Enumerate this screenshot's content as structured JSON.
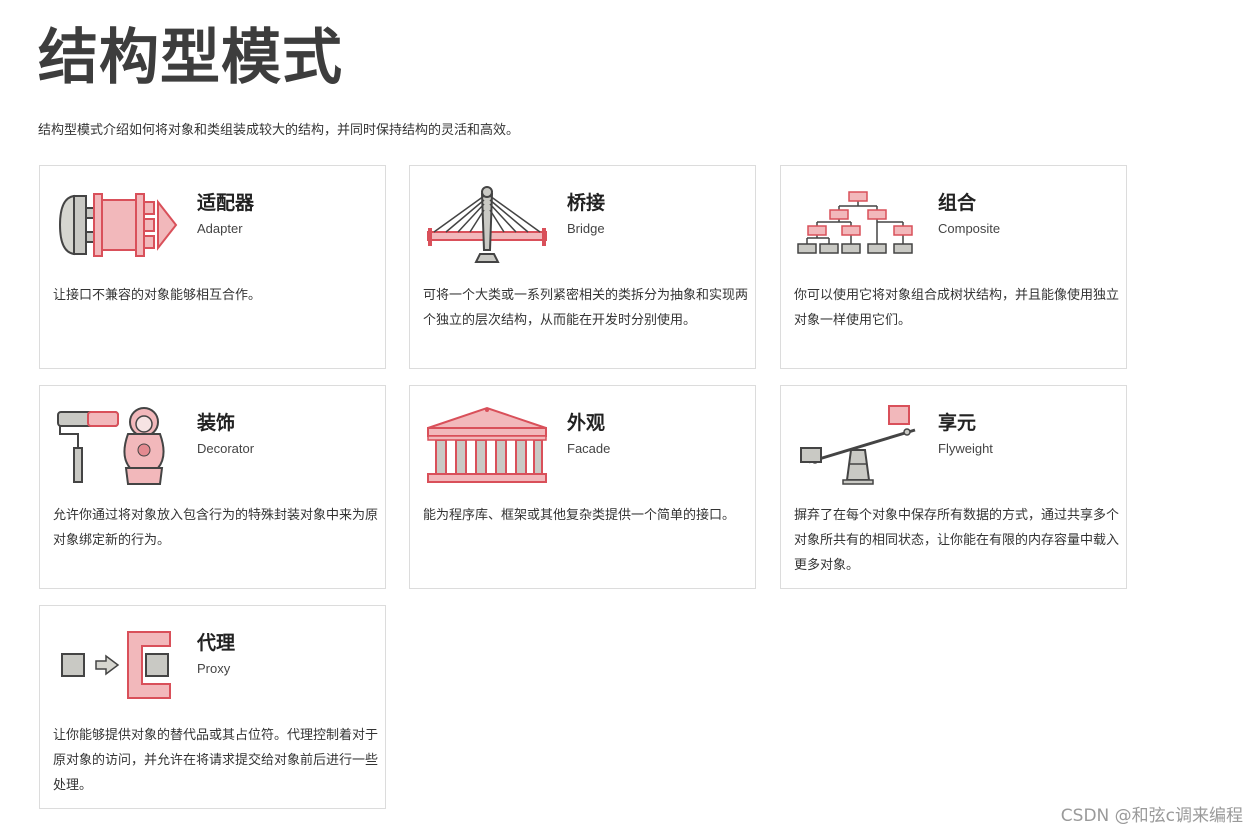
{
  "title": "结构型模式",
  "intro": "结构型模式介绍如何将对象和类组装成较大的结构，并同时保持结构的灵活和高效。",
  "patterns": [
    {
      "name": "适配器",
      "en": "Adapter",
      "desc": "让接口不兼容的对象能够相互合作。",
      "icon": "adapter-icon"
    },
    {
      "name": "桥接",
      "en": "Bridge",
      "desc": "可将一个大类或一系列紧密相关的类拆分为抽象和实现两个独立的层次结构，从而能在开发时分别使用。",
      "icon": "bridge-icon"
    },
    {
      "name": "组合",
      "en": "Composite",
      "desc": "你可以使用它将对象组合成树状结构，并且能像使用独立对象一样使用它们。",
      "icon": "composite-tree-icon"
    },
    {
      "name": "装饰",
      "en": "Decorator",
      "desc": "允许你通过将对象放入包含行为的特殊封装对象中来为原对象绑定新的行为。",
      "icon": "decorator-icon"
    },
    {
      "name": "外观",
      "en": "Facade",
      "desc": "能为程序库、框架或其他复杂类提供一个简单的接口。",
      "icon": "facade-building-icon"
    },
    {
      "name": "享元",
      "en": "Flyweight",
      "desc": "摒弃了在每个对象中保存所有数据的方式，通过共享多个对象所共有的相同状态，让你能在有限的内存容量中载入更多对象。",
      "icon": "flyweight-seesaw-icon"
    },
    {
      "name": "代理",
      "en": "Proxy",
      "desc": "让你能够提供对象的替代品或其占位符。代理控制着对于原对象的访问，并允许在将请求提交给对象前后进行一些处理。",
      "icon": "proxy-icon"
    }
  ],
  "watermark": "CSDN @和弦c调来编程",
  "colors": {
    "accent_red": "#d9505a",
    "accent_fill": "#f2b8bb",
    "gray": "#c9c9c4",
    "stroke": "#444444"
  }
}
